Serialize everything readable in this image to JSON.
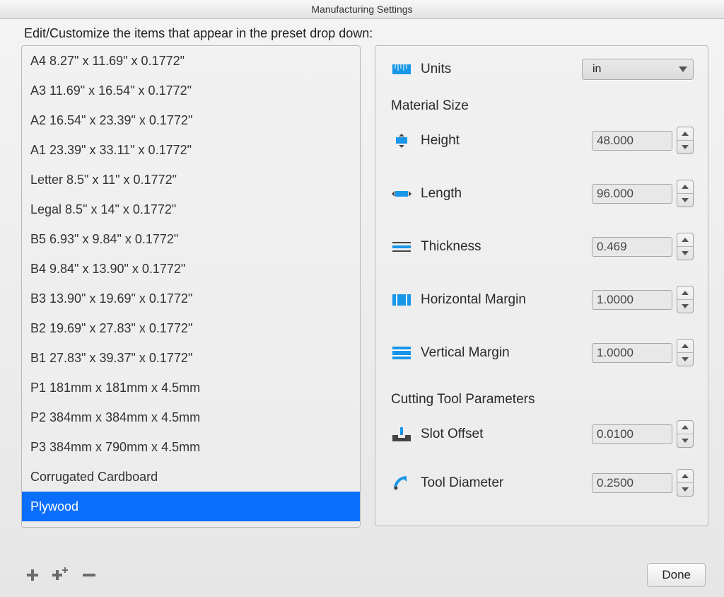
{
  "title": "Manufacturing Settings",
  "subtitle": "Edit/Customize the items that appear in the preset drop down:",
  "presets": [
    "A4 8.27\" x 11.69\" x 0.1772\"",
    "A3 11.69\" x 16.54\" x 0.1772\"",
    "A2 16.54\" x 23.39\" x 0.1772\"",
    "A1 23.39\" x 33.11\" x 0.1772\"",
    "Letter 8.5\" x 11\" x 0.1772\"",
    "Legal 8.5\" x 14\" x 0.1772\"",
    "B5 6.93\" x 9.84\" x 0.1772\"",
    "B4 9.84\" x 13.90\" x 0.1772\"",
    "B3 13.90\" x 19.69\" x 0.1772\"",
    "B2 19.69\" x 27.83\" x 0.1772\"",
    "B1 27.83\" x 39.37\" x 0.1772\"",
    "P1 181mm x 181mm x 4.5mm",
    "P2 384mm x 384mm x 4.5mm",
    "P3 384mm x 790mm x 4.5mm",
    "Corrugated Cardboard",
    "Plywood"
  ],
  "selected_index": 15,
  "units": {
    "label": "Units",
    "value": "in"
  },
  "sections": {
    "material": "Material Size",
    "cutting": "Cutting Tool Parameters"
  },
  "fields": {
    "height": {
      "label": "Height",
      "value": "48.000"
    },
    "length": {
      "label": "Length",
      "value": "96.000"
    },
    "thickness": {
      "label": "Thickness",
      "value": "0.469"
    },
    "hmargin": {
      "label": "Horizontal Margin",
      "value": "1.0000"
    },
    "vmargin": {
      "label": "Vertical Margin",
      "value": "1.0000"
    },
    "slot": {
      "label": "Slot  Offset",
      "value": "0.0100"
    },
    "tooldia": {
      "label": "Tool Diameter",
      "value": "0.2500"
    }
  },
  "buttons": {
    "done": "Done"
  }
}
